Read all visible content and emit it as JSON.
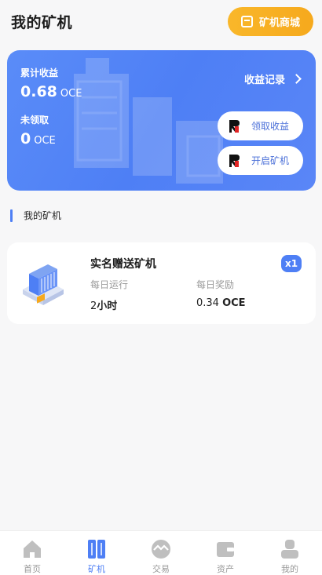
{
  "header": {
    "title": "我的矿机",
    "shop_button": "矿机商城"
  },
  "earnings": {
    "total_label": "累计收益",
    "total_value": "0.68",
    "total_unit": "OCE",
    "unclaimed_label": "未领取",
    "unclaimed_value": "0",
    "unclaimed_unit": "OCE",
    "records_link": "收益记录",
    "claim_button": "领取收益",
    "start_button": "开启矿机"
  },
  "section": {
    "title": "我的矿机"
  },
  "miner": {
    "name": "实名赠送矿机",
    "quantity": "x1",
    "run_label": "每日运行",
    "run_value": "2",
    "run_unit": "小时",
    "reward_label": "每日奖励",
    "reward_value": "0.34",
    "reward_unit": "OCE"
  },
  "nav": [
    {
      "label": "首页",
      "icon": "home-icon",
      "active": false
    },
    {
      "label": "矿机",
      "icon": "miner-icon",
      "active": true
    },
    {
      "label": "交易",
      "icon": "trade-icon",
      "active": false
    },
    {
      "label": "资产",
      "icon": "wallet-icon",
      "active": false
    },
    {
      "label": "我的",
      "icon": "user-icon",
      "active": false
    }
  ],
  "colors": {
    "accent": "#4e7ff5",
    "shop_button": "#f8b125",
    "background": "#f7f7f8"
  }
}
